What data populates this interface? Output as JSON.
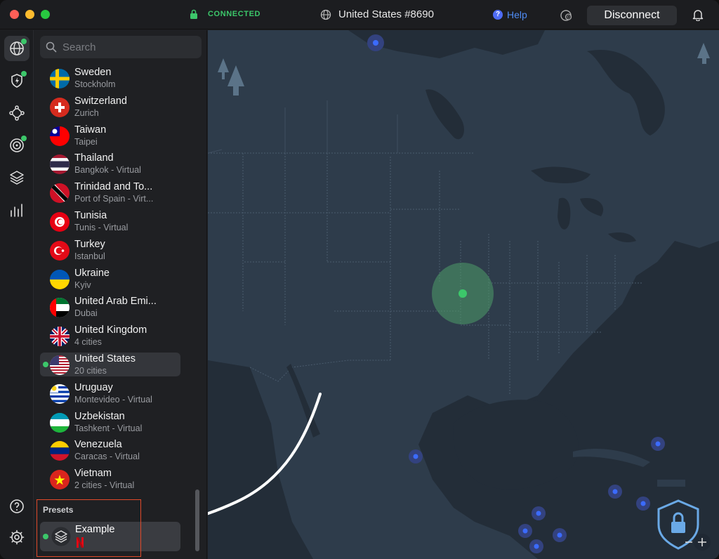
{
  "titlebar": {
    "status": "CONNECTED",
    "server": "United States #8690",
    "help": "Help",
    "disconnect": "Disconnect"
  },
  "search": {
    "placeholder": "Search"
  },
  "countries": [
    {
      "name": "Sweden",
      "sub": "Stockholm",
      "flag": "sweden"
    },
    {
      "name": "Switzerland",
      "sub": "Zurich",
      "flag": "switzerland"
    },
    {
      "name": "Taiwan",
      "sub": "Taipei",
      "flag": "taiwan"
    },
    {
      "name": "Thailand",
      "sub": "Bangkok - Virtual",
      "flag": "thailand"
    },
    {
      "name": "Trinidad and To...",
      "sub": "Port of Spain - Virt...",
      "flag": "trinidad"
    },
    {
      "name": "Tunisia",
      "sub": "Tunis - Virtual",
      "flag": "tunisia"
    },
    {
      "name": "Turkey",
      "sub": "Istanbul",
      "flag": "turkey"
    },
    {
      "name": "Ukraine",
      "sub": "Kyiv",
      "flag": "ukraine"
    },
    {
      "name": "United Arab Emi...",
      "sub": "Dubai",
      "flag": "uae"
    },
    {
      "name": "United Kingdom",
      "sub": "4 cities",
      "flag": "uk"
    },
    {
      "name": "United States",
      "sub": "20 cities",
      "flag": "us",
      "selected": true
    },
    {
      "name": "Uruguay",
      "sub": "Montevideo - Virtual",
      "flag": "uruguay"
    },
    {
      "name": "Uzbekistan",
      "sub": "Tashkent - Virtual",
      "flag": "uzbekistan"
    },
    {
      "name": "Venezuela",
      "sub": "Caracas - Virtual",
      "flag": "venezuela"
    },
    {
      "name": "Vietnam",
      "sub": "2 cities - Virtual",
      "flag": "vietnam"
    }
  ],
  "presets": {
    "label": "Presets",
    "items": [
      {
        "name": "Example",
        "badge": "netflix-logo"
      }
    ]
  },
  "colors": {
    "connected": "#3cc76a",
    "help": "#4f8cf5",
    "map_land": "#2e3c4b",
    "map_sea": "#232d38",
    "server_pin": "#3b52d6",
    "highlight": "#e04a2a"
  }
}
